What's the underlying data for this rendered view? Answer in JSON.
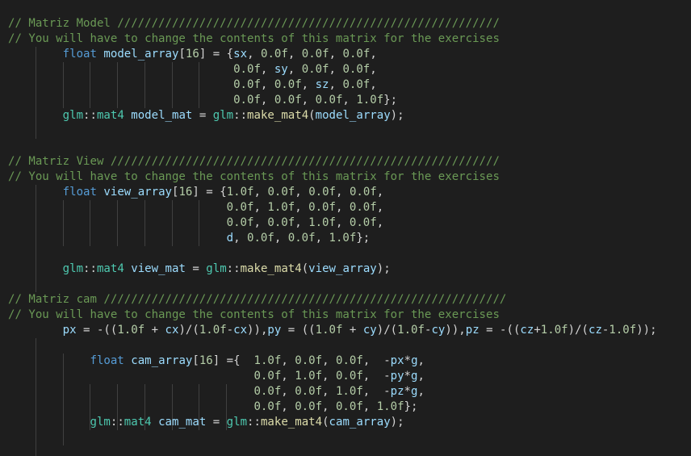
{
  "editor": {
    "theme_colors": {
      "background": "#1e1e1e",
      "comment": "#6a9955",
      "keyword": "#569cd6",
      "type": "#4ec9b0",
      "variable": "#9cdcfe",
      "number": "#b5cea8",
      "function": "#dcdcaa",
      "text": "#d4d4d4"
    },
    "lines": [
      {
        "indent": 0,
        "tokens": [
          {
            "c": "c",
            "t": "// Matriz Model ////////////////////////////////////////////////////////"
          }
        ]
      },
      {
        "indent": 0,
        "tokens": [
          {
            "c": "c",
            "t": "// You will have to change the contents of this matrix for the exercises"
          }
        ]
      },
      {
        "indent": 8,
        "tokens": [
          {
            "c": "k",
            "t": "float"
          },
          {
            "c": "p",
            "t": " "
          },
          {
            "c": "v",
            "t": "model_array"
          },
          {
            "c": "p",
            "t": "["
          },
          {
            "c": "n",
            "t": "16"
          },
          {
            "c": "p",
            "t": "] = {"
          },
          {
            "c": "v",
            "t": "sx"
          },
          {
            "c": "p",
            "t": ", "
          },
          {
            "c": "n",
            "t": "0.0f"
          },
          {
            "c": "p",
            "t": ", "
          },
          {
            "c": "n",
            "t": "0.0f"
          },
          {
            "c": "p",
            "t": ", "
          },
          {
            "c": "n",
            "t": "0.0f"
          },
          {
            "c": "p",
            "t": ","
          }
        ]
      },
      {
        "indent": 33,
        "tokens": [
          {
            "c": "n",
            "t": "0.0f"
          },
          {
            "c": "p",
            "t": ", "
          },
          {
            "c": "v",
            "t": "sy"
          },
          {
            "c": "p",
            "t": ", "
          },
          {
            "c": "n",
            "t": "0.0f"
          },
          {
            "c": "p",
            "t": ", "
          },
          {
            "c": "n",
            "t": "0.0f"
          },
          {
            "c": "p",
            "t": ","
          }
        ]
      },
      {
        "indent": 33,
        "tokens": [
          {
            "c": "n",
            "t": "0.0f"
          },
          {
            "c": "p",
            "t": ", "
          },
          {
            "c": "n",
            "t": "0.0f"
          },
          {
            "c": "p",
            "t": ", "
          },
          {
            "c": "v",
            "t": "sz"
          },
          {
            "c": "p",
            "t": ", "
          },
          {
            "c": "n",
            "t": "0.0f"
          },
          {
            "c": "p",
            "t": ","
          }
        ]
      },
      {
        "indent": 33,
        "tokens": [
          {
            "c": "n",
            "t": "0.0f"
          },
          {
            "c": "p",
            "t": ", "
          },
          {
            "c": "n",
            "t": "0.0f"
          },
          {
            "c": "p",
            "t": ", "
          },
          {
            "c": "n",
            "t": "0.0f"
          },
          {
            "c": "p",
            "t": ", "
          },
          {
            "c": "n",
            "t": "1.0f"
          },
          {
            "c": "p",
            "t": "};"
          }
        ]
      },
      {
        "indent": 8,
        "tokens": [
          {
            "c": "t",
            "t": "glm"
          },
          {
            "c": "p",
            "t": "::"
          },
          {
            "c": "t",
            "t": "mat4"
          },
          {
            "c": "p",
            "t": " "
          },
          {
            "c": "v",
            "t": "model_mat"
          },
          {
            "c": "p",
            "t": " = "
          },
          {
            "c": "t",
            "t": "glm"
          },
          {
            "c": "p",
            "t": "::"
          },
          {
            "c": "f",
            "t": "make_mat4"
          },
          {
            "c": "p",
            "t": "("
          },
          {
            "c": "v",
            "t": "model_array"
          },
          {
            "c": "p",
            "t": ");"
          }
        ]
      },
      {
        "indent": 0,
        "tokens": []
      },
      {
        "indent": 0,
        "tokens": []
      },
      {
        "indent": 0,
        "tokens": [
          {
            "c": "c",
            "t": "// Matriz View /////////////////////////////////////////////////////////"
          }
        ]
      },
      {
        "indent": 0,
        "tokens": [
          {
            "c": "c",
            "t": "// You will have to change the contents of this matrix for the exercises"
          }
        ]
      },
      {
        "indent": 8,
        "tokens": [
          {
            "c": "k",
            "t": "float"
          },
          {
            "c": "p",
            "t": " "
          },
          {
            "c": "v",
            "t": "view_array"
          },
          {
            "c": "p",
            "t": "["
          },
          {
            "c": "n",
            "t": "16"
          },
          {
            "c": "p",
            "t": "] = {"
          },
          {
            "c": "n",
            "t": "1.0f"
          },
          {
            "c": "p",
            "t": ", "
          },
          {
            "c": "n",
            "t": "0.0f"
          },
          {
            "c": "p",
            "t": ", "
          },
          {
            "c": "n",
            "t": "0.0f"
          },
          {
            "c": "p",
            "t": ", "
          },
          {
            "c": "n",
            "t": "0.0f"
          },
          {
            "c": "p",
            "t": ","
          }
        ]
      },
      {
        "indent": 32,
        "tokens": [
          {
            "c": "n",
            "t": "0.0f"
          },
          {
            "c": "p",
            "t": ", "
          },
          {
            "c": "n",
            "t": "1.0f"
          },
          {
            "c": "p",
            "t": ", "
          },
          {
            "c": "n",
            "t": "0.0f"
          },
          {
            "c": "p",
            "t": ", "
          },
          {
            "c": "n",
            "t": "0.0f"
          },
          {
            "c": "p",
            "t": ","
          }
        ]
      },
      {
        "indent": 32,
        "tokens": [
          {
            "c": "n",
            "t": "0.0f"
          },
          {
            "c": "p",
            "t": ", "
          },
          {
            "c": "n",
            "t": "0.0f"
          },
          {
            "c": "p",
            "t": ", "
          },
          {
            "c": "n",
            "t": "1.0f"
          },
          {
            "c": "p",
            "t": ", "
          },
          {
            "c": "n",
            "t": "0.0f"
          },
          {
            "c": "p",
            "t": ","
          }
        ]
      },
      {
        "indent": 32,
        "tokens": [
          {
            "c": "v",
            "t": "d"
          },
          {
            "c": "p",
            "t": ", "
          },
          {
            "c": "n",
            "t": "0.0f"
          },
          {
            "c": "p",
            "t": ", "
          },
          {
            "c": "n",
            "t": "0.0f"
          },
          {
            "c": "p",
            "t": ", "
          },
          {
            "c": "n",
            "t": "1.0f"
          },
          {
            "c": "p",
            "t": "};"
          }
        ]
      },
      {
        "indent": 0,
        "tokens": []
      },
      {
        "indent": 8,
        "tokens": [
          {
            "c": "t",
            "t": "glm"
          },
          {
            "c": "p",
            "t": "::"
          },
          {
            "c": "t",
            "t": "mat4"
          },
          {
            "c": "p",
            "t": " "
          },
          {
            "c": "v",
            "t": "view_mat"
          },
          {
            "c": "p",
            "t": " = "
          },
          {
            "c": "t",
            "t": "glm"
          },
          {
            "c": "p",
            "t": "::"
          },
          {
            "c": "f",
            "t": "make_mat4"
          },
          {
            "c": "p",
            "t": "("
          },
          {
            "c": "v",
            "t": "view_array"
          },
          {
            "c": "p",
            "t": ");"
          }
        ]
      },
      {
        "indent": 0,
        "tokens": []
      },
      {
        "indent": 0,
        "tokens": [
          {
            "c": "c",
            "t": "// Matriz cam ///////////////////////////////////////////////////////////"
          }
        ]
      },
      {
        "indent": 0,
        "tokens": [
          {
            "c": "c",
            "t": "// You will have to change the contents of this matrix for the exercises"
          }
        ]
      },
      {
        "indent": 8,
        "tokens": [
          {
            "c": "v",
            "t": "px"
          },
          {
            "c": "p",
            "t": " = -(("
          },
          {
            "c": "n",
            "t": "1.0f"
          },
          {
            "c": "p",
            "t": " + "
          },
          {
            "c": "v",
            "t": "cx"
          },
          {
            "c": "p",
            "t": ")/("
          },
          {
            "c": "n",
            "t": "1.0f"
          },
          {
            "c": "p",
            "t": "-"
          },
          {
            "c": "v",
            "t": "cx"
          },
          {
            "c": "p",
            "t": ")),"
          },
          {
            "c": "v",
            "t": "py"
          },
          {
            "c": "p",
            "t": " = (("
          },
          {
            "c": "n",
            "t": "1.0f"
          },
          {
            "c": "p",
            "t": " + "
          },
          {
            "c": "v",
            "t": "cy"
          },
          {
            "c": "p",
            "t": ")/("
          },
          {
            "c": "n",
            "t": "1.0f"
          },
          {
            "c": "p",
            "t": "-"
          },
          {
            "c": "v",
            "t": "cy"
          },
          {
            "c": "p",
            "t": ")),"
          },
          {
            "c": "v",
            "t": "pz"
          },
          {
            "c": "p",
            "t": " = -(("
          },
          {
            "c": "v",
            "t": "cz"
          },
          {
            "c": "p",
            "t": "+"
          },
          {
            "c": "n",
            "t": "1.0f"
          },
          {
            "c": "p",
            "t": ")/("
          },
          {
            "c": "v",
            "t": "cz"
          },
          {
            "c": "p",
            "t": "-"
          },
          {
            "c": "n",
            "t": "1.0f"
          },
          {
            "c": "p",
            "t": "));"
          }
        ]
      },
      {
        "indent": 0,
        "tokens": []
      },
      {
        "indent": 12,
        "tokens": [
          {
            "c": "k",
            "t": "float"
          },
          {
            "c": "p",
            "t": " "
          },
          {
            "c": "v",
            "t": "cam_array"
          },
          {
            "c": "p",
            "t": "["
          },
          {
            "c": "n",
            "t": "16"
          },
          {
            "c": "p",
            "t": "] ={  "
          },
          {
            "c": "n",
            "t": "1.0f"
          },
          {
            "c": "p",
            "t": ", "
          },
          {
            "c": "n",
            "t": "0.0f"
          },
          {
            "c": "p",
            "t": ", "
          },
          {
            "c": "n",
            "t": "0.0f"
          },
          {
            "c": "p",
            "t": ",  -"
          },
          {
            "c": "v",
            "t": "px"
          },
          {
            "c": "p",
            "t": "*"
          },
          {
            "c": "v",
            "t": "g"
          },
          {
            "c": "p",
            "t": ","
          }
        ]
      },
      {
        "indent": 36,
        "tokens": [
          {
            "c": "n",
            "t": "0.0f"
          },
          {
            "c": "p",
            "t": ", "
          },
          {
            "c": "n",
            "t": "1.0f"
          },
          {
            "c": "p",
            "t": ", "
          },
          {
            "c": "n",
            "t": "0.0f"
          },
          {
            "c": "p",
            "t": ",  -"
          },
          {
            "c": "v",
            "t": "py"
          },
          {
            "c": "p",
            "t": "*"
          },
          {
            "c": "v",
            "t": "g"
          },
          {
            "c": "p",
            "t": ","
          }
        ]
      },
      {
        "indent": 36,
        "tokens": [
          {
            "c": "n",
            "t": "0.0f"
          },
          {
            "c": "p",
            "t": ", "
          },
          {
            "c": "n",
            "t": "0.0f"
          },
          {
            "c": "p",
            "t": ", "
          },
          {
            "c": "n",
            "t": "1.0f"
          },
          {
            "c": "p",
            "t": ",  -"
          },
          {
            "c": "v",
            "t": "pz"
          },
          {
            "c": "p",
            "t": "*"
          },
          {
            "c": "v",
            "t": "g"
          },
          {
            "c": "p",
            "t": ","
          }
        ]
      },
      {
        "indent": 36,
        "tokens": [
          {
            "c": "n",
            "t": "0.0f"
          },
          {
            "c": "p",
            "t": ", "
          },
          {
            "c": "n",
            "t": "0.0f"
          },
          {
            "c": "p",
            "t": ", "
          },
          {
            "c": "n",
            "t": "0.0f"
          },
          {
            "c": "p",
            "t": ", "
          },
          {
            "c": "n",
            "t": "1.0f"
          },
          {
            "c": "p",
            "t": "};"
          }
        ]
      },
      {
        "indent": 12,
        "tokens": [
          {
            "c": "t",
            "t": "glm"
          },
          {
            "c": "p",
            "t": "::"
          },
          {
            "c": "t",
            "t": "mat4"
          },
          {
            "c": "p",
            "t": " "
          },
          {
            "c": "v",
            "t": "cam_mat"
          },
          {
            "c": "p",
            "t": " = "
          },
          {
            "c": "t",
            "t": "glm"
          },
          {
            "c": "p",
            "t": "::"
          },
          {
            "c": "f",
            "t": "make_mat4"
          },
          {
            "c": "p",
            "t": "("
          },
          {
            "c": "v",
            "t": "cam_array"
          },
          {
            "c": "p",
            "t": ");"
          }
        ]
      }
    ]
  }
}
